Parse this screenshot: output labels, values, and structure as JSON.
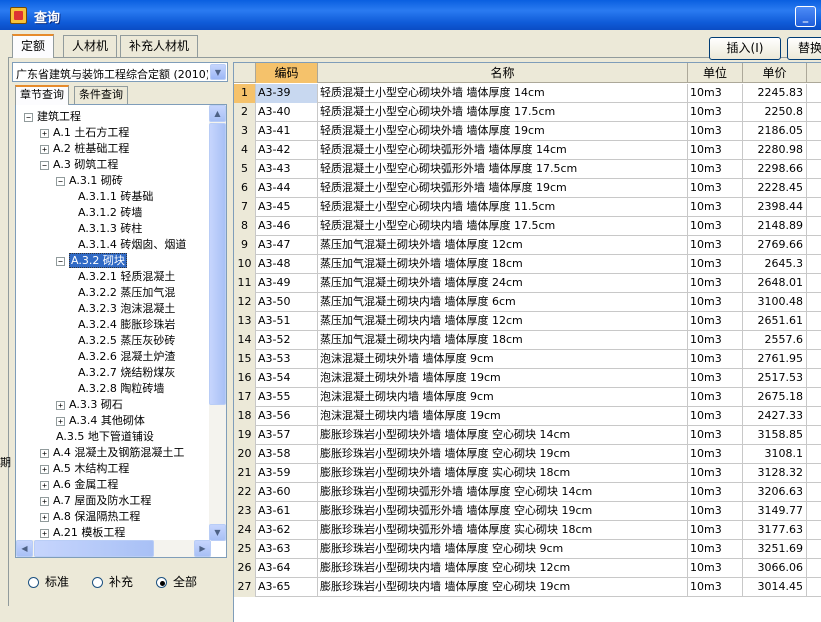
{
  "window": {
    "title": "查询",
    "minimize_glyph": "_",
    "maximize_glyph": "□"
  },
  "tabs": [
    "定额",
    "人材机",
    "补充人材机"
  ],
  "buttons": {
    "insert": "插入(I)",
    "replace": "替换"
  },
  "left": {
    "library_select": "广东省建筑与装饰工程综合定额 (2010)",
    "subtabs": [
      "章节查询",
      "条件查询"
    ],
    "tree": [
      {
        "label": "建筑工程",
        "level": 0,
        "expander": "−"
      },
      {
        "label": "A.1 土石方工程",
        "level": 1,
        "expander": "+"
      },
      {
        "label": "A.2 桩基础工程",
        "level": 1,
        "expander": "+"
      },
      {
        "label": "A.3 砌筑工程",
        "level": 1,
        "expander": "−"
      },
      {
        "label": "A.3.1 砌砖",
        "level": 2,
        "expander": "−"
      },
      {
        "label": "A.3.1.1 砖基础",
        "level": 3,
        "expander": ""
      },
      {
        "label": "A.3.1.2 砖墙",
        "level": 3,
        "expander": ""
      },
      {
        "label": "A.3.1.3 砖柱",
        "level": 3,
        "expander": ""
      },
      {
        "label": "A.3.1.4 砖烟囱、烟道",
        "level": 3,
        "expander": ""
      },
      {
        "label": "A.3.2 砌块",
        "level": 2,
        "expander": "−",
        "selected": true
      },
      {
        "label": "A.3.2.1 轻质混凝土",
        "level": 3,
        "expander": ""
      },
      {
        "label": "A.3.2.2 蒸压加气混",
        "level": 3,
        "expander": ""
      },
      {
        "label": "A.3.2.3 泡沫混凝土",
        "level": 3,
        "expander": ""
      },
      {
        "label": "A.3.2.4 膨胀珍珠岩",
        "level": 3,
        "expander": ""
      },
      {
        "label": "A.3.2.5 蒸压灰砂砖",
        "level": 3,
        "expander": ""
      },
      {
        "label": "A.3.2.6 混凝土炉渣",
        "level": 3,
        "expander": ""
      },
      {
        "label": "A.3.2.7 烧结粉煤灰",
        "level": 3,
        "expander": ""
      },
      {
        "label": "A.3.2.8 陶粒砖墙",
        "level": 3,
        "expander": ""
      },
      {
        "label": "A.3.3 砌石",
        "level": 2,
        "expander": "+"
      },
      {
        "label": "A.3.4 其他砌体",
        "level": 2,
        "expander": "+"
      },
      {
        "label": "A.3.5 地下管道铺设",
        "level": 2,
        "expander": ""
      },
      {
        "label": "A.4 混凝土及钢筋混凝土工",
        "level": 1,
        "expander": "+"
      },
      {
        "label": "A.5 木结构工程",
        "level": 1,
        "expander": "+"
      },
      {
        "label": "A.6 金属工程",
        "level": 1,
        "expander": "+"
      },
      {
        "label": "A.7 屋面及防水工程",
        "level": 1,
        "expander": "+"
      },
      {
        "label": "A.8 保温隔热工程",
        "level": 1,
        "expander": "+"
      },
      {
        "label": "A.21 模板工程",
        "level": 1,
        "expander": "+"
      }
    ],
    "radios": [
      {
        "label": "标准",
        "checked": false
      },
      {
        "label": "补充",
        "checked": false
      },
      {
        "label": "全部",
        "checked": true
      }
    ],
    "side_stub": "期"
  },
  "grid": {
    "headers": [
      "",
      "编码",
      "名称",
      "单位",
      "单价"
    ],
    "rows": [
      [
        "1",
        "A3-39",
        "轻质混凝土小型空心砌块外墙 墙体厚度 14cm",
        "10m3",
        "2245.83"
      ],
      [
        "2",
        "A3-40",
        "轻质混凝土小型空心砌块外墙 墙体厚度 17.5cm",
        "10m3",
        "2250.8"
      ],
      [
        "3",
        "A3-41",
        "轻质混凝土小型空心砌块外墙 墙体厚度 19cm",
        "10m3",
        "2186.05"
      ],
      [
        "4",
        "A3-42",
        "轻质混凝土小型空心砌块弧形外墙 墙体厚度 14cm",
        "10m3",
        "2280.98"
      ],
      [
        "5",
        "A3-43",
        "轻质混凝土小型空心砌块弧形外墙 墙体厚度 17.5cm",
        "10m3",
        "2298.66"
      ],
      [
        "6",
        "A3-44",
        "轻质混凝土小型空心砌块弧形外墙 墙体厚度 19cm",
        "10m3",
        "2228.45"
      ],
      [
        "7",
        "A3-45",
        "轻质混凝土小型空心砌块内墙 墙体厚度 11.5cm",
        "10m3",
        "2398.44"
      ],
      [
        "8",
        "A3-46",
        "轻质混凝土小型空心砌块内墙 墙体厚度 17.5cm",
        "10m3",
        "2148.89"
      ],
      [
        "9",
        "A3-47",
        "蒸压加气混凝土砌块外墙 墙体厚度 12cm",
        "10m3",
        "2769.66"
      ],
      [
        "10",
        "A3-48",
        "蒸压加气混凝土砌块外墙 墙体厚度 18cm",
        "10m3",
        "2645.3"
      ],
      [
        "11",
        "A3-49",
        "蒸压加气混凝土砌块外墙 墙体厚度 24cm",
        "10m3",
        "2648.01"
      ],
      [
        "12",
        "A3-50",
        "蒸压加气混凝土砌块内墙 墙体厚度 6cm",
        "10m3",
        "3100.48"
      ],
      [
        "13",
        "A3-51",
        "蒸压加气混凝土砌块内墙 墙体厚度 12cm",
        "10m3",
        "2651.61"
      ],
      [
        "14",
        "A3-52",
        "蒸压加气混凝土砌块内墙 墙体厚度 18cm",
        "10m3",
        "2557.6"
      ],
      [
        "15",
        "A3-53",
        "泡沫混凝土砌块外墙 墙体厚度 9cm",
        "10m3",
        "2761.95"
      ],
      [
        "16",
        "A3-54",
        "泡沫混凝土砌块外墙 墙体厚度 19cm",
        "10m3",
        "2517.53"
      ],
      [
        "17",
        "A3-55",
        "泡沫混凝土砌块内墙 墙体厚度 9cm",
        "10m3",
        "2675.18"
      ],
      [
        "18",
        "A3-56",
        "泡沫混凝土砌块内墙 墙体厚度 19cm",
        "10m3",
        "2427.33"
      ],
      [
        "19",
        "A3-57",
        "膨胀珍珠岩小型砌块外墙 墙体厚度 空心砌块 14cm",
        "10m3",
        "3158.85"
      ],
      [
        "20",
        "A3-58",
        "膨胀珍珠岩小型砌块外墙 墙体厚度 空心砌块 19cm",
        "10m3",
        "3108.1"
      ],
      [
        "21",
        "A3-59",
        "膨胀珍珠岩小型砌块外墙 墙体厚度 实心砌块 18cm",
        "10m3",
        "3128.32"
      ],
      [
        "22",
        "A3-60",
        "膨胀珍珠岩小型砌块弧形外墙 墙体厚度 空心砌块 14cm",
        "10m3",
        "3206.63"
      ],
      [
        "23",
        "A3-61",
        "膨胀珍珠岩小型砌块弧形外墙 墙体厚度 空心砌块 19cm",
        "10m3",
        "3149.77"
      ],
      [
        "24",
        "A3-62",
        "膨胀珍珠岩小型砌块弧形外墙 墙体厚度 实心砌块 18cm",
        "10m3",
        "3177.63"
      ],
      [
        "25",
        "A3-63",
        "膨胀珍珠岩小型砌块内墙 墙体厚度 空心砌块 9cm",
        "10m3",
        "3251.69"
      ],
      [
        "26",
        "A3-64",
        "膨胀珍珠岩小型砌块内墙 墙体厚度 空心砌块 12cm",
        "10m3",
        "3066.06"
      ],
      [
        "27",
        "A3-65",
        "膨胀珍珠岩小型砌块内墙 墙体厚度 空心砌块 19cm",
        "10m3",
        "3014.45"
      ]
    ]
  },
  "colors": {
    "selection": "#f5c26b",
    "titlebar": "#0a5fe0"
  }
}
